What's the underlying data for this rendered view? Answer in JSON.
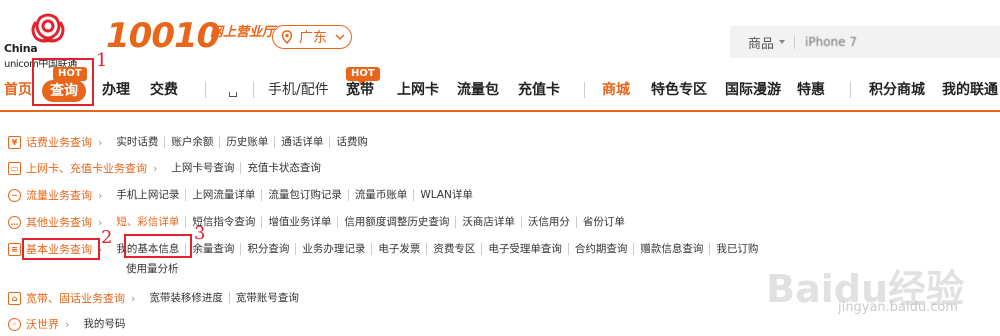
{
  "header": {
    "logo_china": "China",
    "logo_unicom": "unicom中国联通",
    "brand_number": "10010",
    "brand_sub": "网上营业厅",
    "region": "广东",
    "search_category": "商品",
    "search_placeholder": "iPhone 7"
  },
  "nav": {
    "items": [
      {
        "label": "首页"
      },
      {
        "label": "查询",
        "hot": "HOT"
      },
      {
        "label": "办理"
      },
      {
        "label": "交费"
      },
      {
        "label": "手机/配件"
      },
      {
        "label": "宽带",
        "hot": "HOT"
      },
      {
        "label": "上网卡"
      },
      {
        "label": "流量包"
      },
      {
        "label": "充值卡"
      },
      {
        "label": "商城"
      },
      {
        "label": "特色专区"
      },
      {
        "label": "国际漫游"
      },
      {
        "label": "特惠"
      },
      {
        "label": "积分商城"
      },
      {
        "label": "我的联通"
      }
    ],
    "annotation_1": "1"
  },
  "menu": {
    "rows": [
      {
        "category": "话费业务查询",
        "links": [
          "实时话费",
          "账户余额",
          "历史账单",
          "通话详单",
          "话费购"
        ]
      },
      {
        "category": "上网卡、充值卡业务查询",
        "links": [
          "上网卡号查询",
          "充值卡状态查询"
        ]
      },
      {
        "category": "流量业务查询",
        "links": [
          "手机上网记录",
          "上网流量详单",
          "流量包订购记录",
          "流量币账单",
          "WLAN详单"
        ]
      },
      {
        "category": "其他业务查询",
        "links": [
          "短、彩信详单",
          "短信指令查询",
          "增值业务详单",
          "信用额度调整历史查询",
          "沃商店详单",
          "沃信用分",
          "省份订单"
        ]
      },
      {
        "category": "基本业务查询",
        "links": [
          "我的基本信息",
          "余量查询",
          "积分查询",
          "业务办理记录",
          "电子发票",
          "资费专区",
          "电子受理单查询",
          "合约期查询",
          "赠款信息查询",
          "我已订购"
        ],
        "extra": "使用量分析"
      },
      {
        "category": "宽带、固话业务查询",
        "links": [
          "宽带装移修进度",
          "宽带账号查询"
        ]
      },
      {
        "category": "沃世界",
        "links": [
          "我的号码"
        ]
      }
    ],
    "annotation_2": "2",
    "annotation_3": "3"
  },
  "watermark": {
    "text": "Baidu经验",
    "url": "jingyan.baidu.com"
  },
  "colors": {
    "accent": "#e8651a",
    "annotation_red": "#e3232c"
  }
}
